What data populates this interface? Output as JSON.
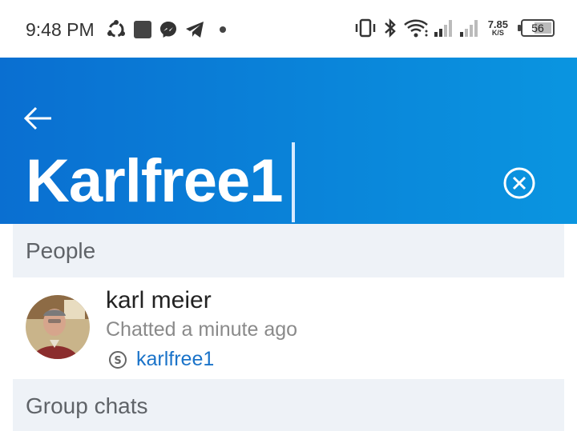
{
  "status_bar": {
    "time": "9:48 PM",
    "notification_icons": [
      "sync-icon",
      "square-app-icon",
      "messenger-icon",
      "telegram-icon",
      "dot-icon"
    ],
    "net_speed_value": "7.85",
    "net_speed_unit": "K/S",
    "battery_level": "56"
  },
  "app_bar": {
    "search_query": "Karlfree1"
  },
  "sections": {
    "people_label": "People",
    "groups_label": "Group chats"
  },
  "result": {
    "name": "karl meier",
    "subtitle": "Chatted a minute ago",
    "skype_id": "karlfree1"
  },
  "colors": {
    "accent": "#0a7fd6",
    "link": "#1a73c9",
    "section_bg": "#eef2f7"
  }
}
